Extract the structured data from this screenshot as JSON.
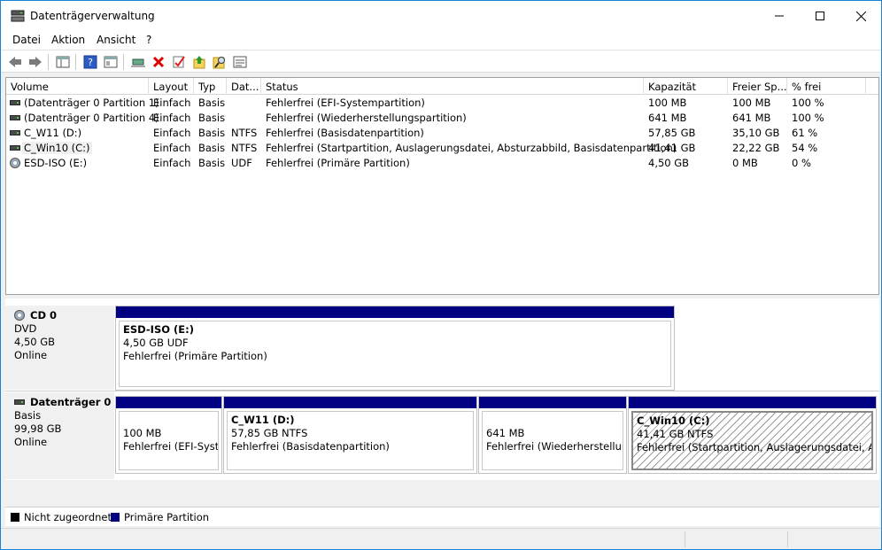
{
  "window": {
    "title": "Datenträgerverwaltung"
  },
  "menu": [
    "Datei",
    "Aktion",
    "Ansicht",
    "?"
  ],
  "toolbar": [
    "back-arrow-icon",
    "forward-arrow-icon",
    "show-hide-console-tree-icon",
    "help-icon",
    "properties-icon",
    "connect-icon",
    "delete-icon",
    "check-icon",
    "upload-icon",
    "search-icon",
    "list-view-icon"
  ],
  "columns": [
    "Volume",
    "Layout",
    "Typ",
    "Dat...",
    "Status",
    "Kapazität",
    "Freier Sp...",
    "% frei"
  ],
  "volumes": [
    {
      "icon": "volume",
      "name": "(Datenträger 0 Partition 1)",
      "layout": "Einfach",
      "type": "Basis",
      "fs": "",
      "status": "Fehlerfrei (EFI-Systempartition)",
      "capacity": "100 MB",
      "free": "100 MB",
      "pct": "100 %"
    },
    {
      "icon": "volume",
      "name": "(Datenträger 0 Partition 4)",
      "layout": "Einfach",
      "type": "Basis",
      "fs": "",
      "status": "Fehlerfrei (Wiederherstellungspartition)",
      "capacity": "641 MB",
      "free": "641 MB",
      "pct": "100 %"
    },
    {
      "icon": "volume",
      "name": "C_W11 (D:)",
      "layout": "Einfach",
      "type": "Basis",
      "fs": "NTFS",
      "status": "Fehlerfrei (Basisdatenpartition)",
      "capacity": "57,85 GB",
      "free": "35,10 GB",
      "pct": "61 %"
    },
    {
      "icon": "volume",
      "name": "C_Win10 (C:)",
      "layout": "Einfach",
      "type": "Basis",
      "fs": "NTFS",
      "status": "Fehlerfrei (Startpartition, Auslagerungsdatei, Absturzabbild, Basisdatenpartition)",
      "capacity": "41,41 GB",
      "free": "22,22 GB",
      "pct": "54 %"
    },
    {
      "icon": "cd",
      "name": "ESD-ISO (E:)",
      "layout": "Einfach",
      "type": "Basis",
      "fs": "UDF",
      "status": "Fehlerfrei (Primäre Partition)",
      "capacity": "4,50 GB",
      "free": "0 MB",
      "pct": "0 %"
    }
  ],
  "disks": {
    "cd0": {
      "name": "CD 0",
      "kind": "DVD",
      "size": "4,50 GB",
      "state": "Online",
      "partition": {
        "title": "ESD-ISO  (E:)",
        "line1": "4,50 GB UDF",
        "line2": "Fehlerfrei (Primäre Partition)"
      }
    },
    "disk0": {
      "name": "Datenträger 0",
      "kind": "Basis",
      "size": "99,98 GB",
      "state": "Online",
      "partitions": [
        {
          "title": "",
          "line1": "100 MB",
          "line2": "Fehlerfrei (EFI-Syster"
        },
        {
          "title": "C_W11  (D:)",
          "line1": "57,85 GB NTFS",
          "line2": "Fehlerfrei (Basisdatenpartition)"
        },
        {
          "title": "",
          "line1": "641 MB",
          "line2": "Fehlerfrei (Wiederherstellung"
        },
        {
          "title": "C_Win10  (C:)",
          "line1": "41,41 GB NTFS",
          "line2": "Fehlerfrei (Startpartition, Auslagerungsdatei, Abstu"
        }
      ]
    }
  },
  "legend": [
    {
      "color": "#000000",
      "label": "Nicht zugeordnet"
    },
    {
      "color": "#000080",
      "label": "Primäre Partition"
    }
  ]
}
